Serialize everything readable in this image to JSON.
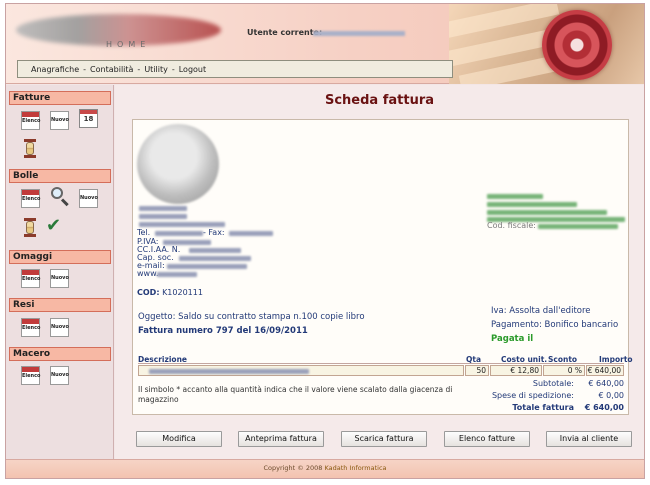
{
  "header": {
    "logo_text": "HOME",
    "user_label": "Utente corrente:"
  },
  "menu": {
    "items": [
      "Anagrafiche",
      "Contabilità",
      "Utility",
      "Logout"
    ],
    "separator": "-"
  },
  "sidebar": {
    "sections": [
      {
        "title": "Fatture",
        "icons": [
          "Elenco",
          "Nuovo",
          "18"
        ]
      },
      {
        "title": "Bolle",
        "icons": [
          "Elenco",
          "search",
          "Nuovo"
        ]
      },
      {
        "title": "Omaggi",
        "icons": [
          "Elenco",
          "Nuovo"
        ]
      },
      {
        "title": "Resi",
        "icons": [
          "Elenco",
          "Nuovo"
        ]
      },
      {
        "title": "Macero",
        "icons": [
          "Elenco",
          "Nuovo"
        ]
      }
    ]
  },
  "main": {
    "title": "Scheda fattura",
    "company": {
      "tel_label": "Tel.",
      "fax_label": "- Fax:",
      "piva_label": "P.IVA:",
      "cciaa_label": "CC.I.AA. N.",
      "cap_label": "Cap. soc.",
      "email_label": "e-mail:",
      "www_label": "www."
    },
    "client": {
      "cf_label": "Cod. fiscale:"
    },
    "cod_label": "COD:",
    "cod_value": "K1020111",
    "oggetto_label": "Oggetto:",
    "oggetto_value": "Saldo su contratto stampa n.100 copie libro",
    "fattura_label": "Fattura numero 797 del 16/09/2011",
    "iva": "Iva: Assolta dall'editore",
    "pagamento": "Pagamento: Bonifico bancario",
    "pagata": "Pagata il",
    "table": {
      "headers": [
        "Descrizione",
        "Qta",
        "Costo unit.",
        "Sconto",
        "Importo"
      ],
      "row": {
        "qta": "50",
        "costo": "€ 12,80",
        "sconto": "0 %",
        "importo": "€ 640,00"
      }
    },
    "note": "Il simbolo * accanto alla quantità indica che il valore viene scalato dalla giacenza di magazzino",
    "totals": {
      "subtotale_label": "Subtotale:",
      "subtotale_value": "€ 640,00",
      "spedizione_label": "Spese di spedizione:",
      "spedizione_value": "€ 0,00",
      "totale_label": "Totale fattura",
      "totale_value": "€ 640,00"
    },
    "buttons": [
      "Modifica",
      "Anteprima fattura",
      "Scarica fattura",
      "Elenco fatture",
      "Invia al cliente"
    ]
  },
  "footer": {
    "text": "Copyright © 2008",
    "brand": "Kadath Informatica"
  }
}
